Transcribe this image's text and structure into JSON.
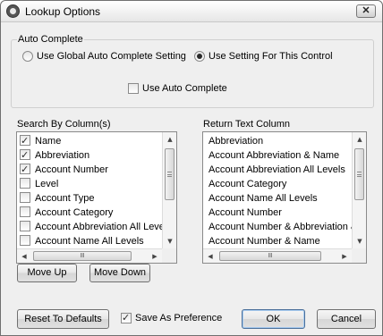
{
  "window": {
    "title": "Lookup Options",
    "close_glyph": "✕"
  },
  "auto_complete": {
    "group_label": "Auto Complete",
    "radio_global_label": "Use Global Auto Complete Setting",
    "radio_control_label": "Use Setting For This Control",
    "selected": "control",
    "use_auto_complete_label": "Use Auto Complete",
    "use_auto_complete_checked": false
  },
  "search_by": {
    "label": "Search By Column(s)",
    "items": [
      {
        "label": "Name",
        "checked": true
      },
      {
        "label": "Abbreviation",
        "checked": true
      },
      {
        "label": "Account Number",
        "checked": true
      },
      {
        "label": "Level",
        "checked": false
      },
      {
        "label": "Account Type",
        "checked": false
      },
      {
        "label": "Account Category",
        "checked": false
      },
      {
        "label": "Account Abbreviation All Levels",
        "checked": false
      },
      {
        "label": "Account Name All Levels",
        "checked": false
      }
    ]
  },
  "return_text": {
    "label": "Return Text Column",
    "items": [
      "Abbreviation",
      "Account Abbreviation & Name",
      "Account Abbreviation All Levels",
      "Account Category",
      "Account Name All Levels",
      "Account Number",
      "Account Number & Abbreviation & N",
      "Account Number & Name"
    ]
  },
  "scroll_glyphs": {
    "up": "▲",
    "down": "▼",
    "left": "◀",
    "right": "▶",
    "grip": "Ⅲ"
  },
  "buttons": {
    "move_up": "Move Up",
    "move_down": "Move Down",
    "reset": "Reset To Defaults",
    "ok": "OK",
    "cancel": "Cancel"
  },
  "save_pref": {
    "label": "Save As Preference",
    "checked": true
  }
}
